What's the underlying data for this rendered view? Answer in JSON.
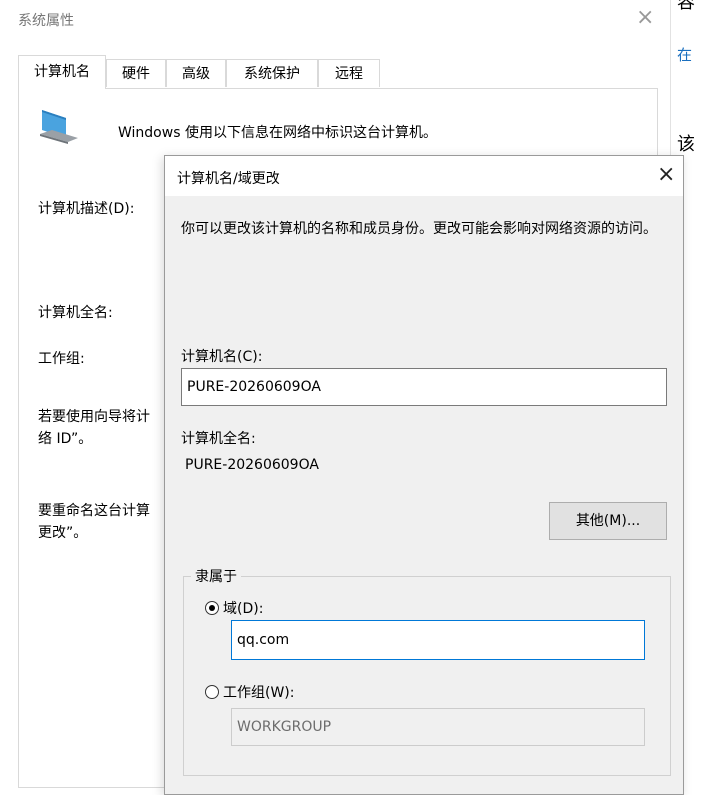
{
  "system_properties": {
    "title": "系统属性",
    "close_glyph": "×",
    "tabs": [
      {
        "label": "计算机名",
        "active": true
      },
      {
        "label": "硬件",
        "active": false
      },
      {
        "label": "高级",
        "active": false
      },
      {
        "label": "系统保护",
        "active": false
      },
      {
        "label": "远程",
        "active": false
      }
    ],
    "intro": "Windows 使用以下信息在网络中标识这台计算机。",
    "description_label": "计算机描述(D):",
    "full_name_label": "计算机全名:",
    "workgroup_label": "工作组:",
    "wizard_text_line1": "若要使用向导将计",
    "wizard_text_line2": "络 ID”。",
    "rename_text_line1": "要重命名这台计算",
    "rename_text_line2": "更改”。"
  },
  "right_sliver": {
    "text1": "容",
    "text2": "在",
    "text3": "该"
  },
  "dialog": {
    "title": "计算机名/域更改",
    "close_glyph": "×",
    "description": "你可以更改该计算机的名称和成员身份。更改可能会影响对网络资源的访问。",
    "computer_name_label": "计算机名(C):",
    "computer_name_value": "PURE-20260609OA",
    "full_name_label": "计算机全名:",
    "full_name_value": "PURE-20260609OA",
    "other_button": "其他(M)...",
    "member_of_legend": "隶属于",
    "domain_radio_label": "域(D):",
    "domain_value": "qq.com",
    "workgroup_radio_label": "工作组(W):",
    "workgroup_value": "WORKGROUP",
    "selected_membership": "domain"
  },
  "colors": {
    "focus_border": "#0078d7",
    "dialog_bg": "#f0f0f0"
  }
}
